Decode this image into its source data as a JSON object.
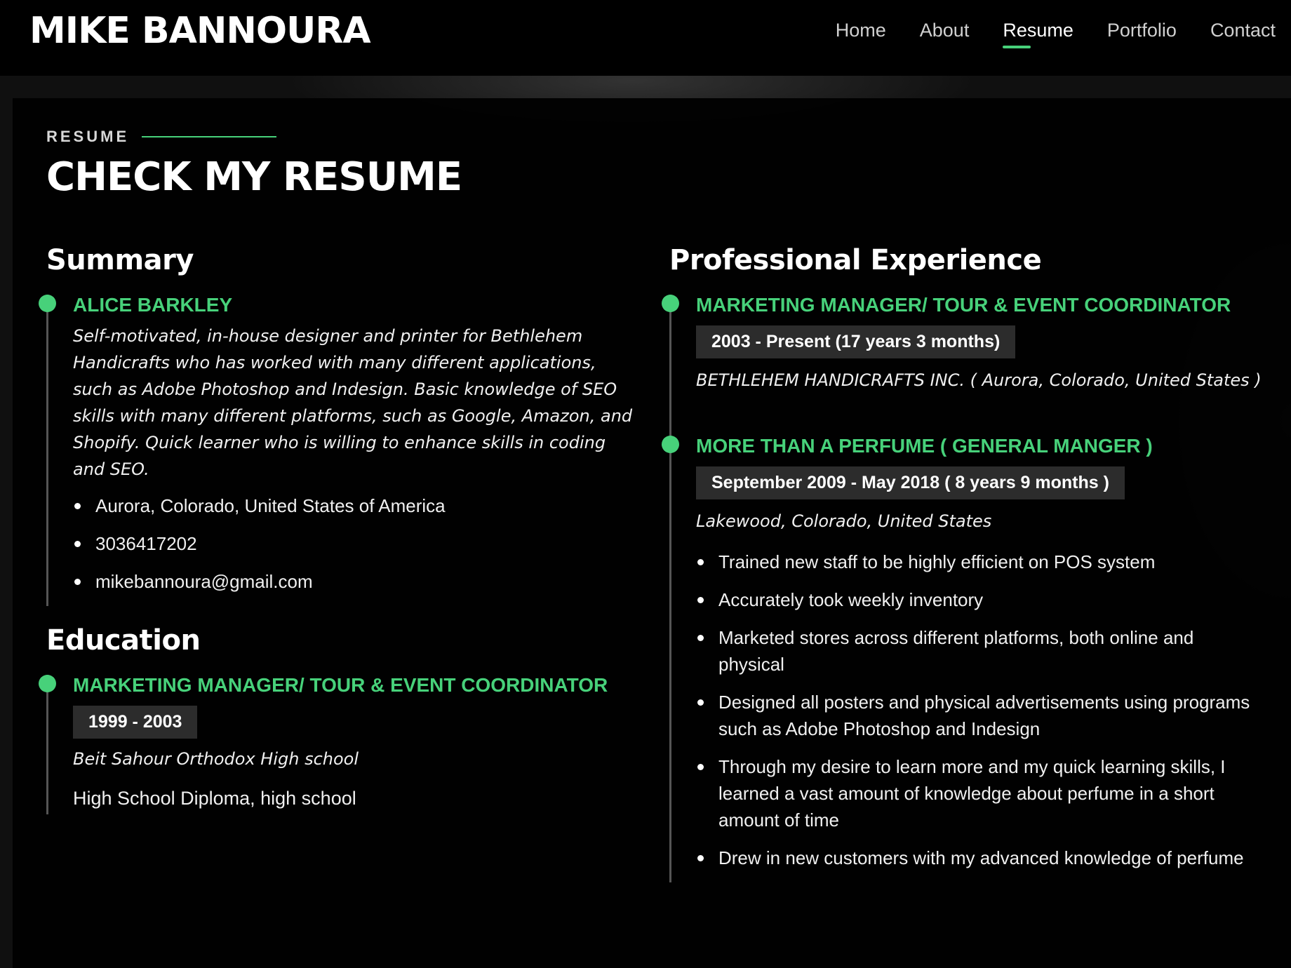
{
  "header": {
    "logo": "MIKE BANNOURA",
    "nav": [
      {
        "label": "Home",
        "active": false
      },
      {
        "label": "About",
        "active": false
      },
      {
        "label": "Resume",
        "active": true
      },
      {
        "label": "Portfolio",
        "active": false
      },
      {
        "label": "Contact",
        "active": false
      }
    ]
  },
  "section": {
    "eyebrow": "RESUME",
    "title": "CHECK MY RESUME"
  },
  "summary": {
    "heading": "Summary",
    "name": "ALICE BARKLEY",
    "description": "Self-motivated, in-house designer and printer for Bethlehem Handicrafts who has worked with many different applications, such as Adobe Photoshop and Indesign. Basic knowledge of SEO skills with many different platforms, such as Google, Amazon, and Shopify. Quick learner who is willing to enhance skills in coding and SEO.",
    "details": [
      "Aurora, Colorado, United States of America",
      "3036417202",
      "mikebannoura@gmail.com"
    ]
  },
  "education": {
    "heading": "Education",
    "item": {
      "title": "MARKETING MANAGER/ TOUR & EVENT COORDINATOR",
      "date": "1999 - 2003",
      "place": "Beit Sahour Orthodox High school",
      "degree": "High School Diploma, high school"
    }
  },
  "experience": {
    "heading": "Professional Experience",
    "items": [
      {
        "title": "MARKETING MANAGER/ TOUR & EVENT COORDINATOR",
        "date": "2003 - Present (17 years 3 months)",
        "place": "BETHLEHEM HANDICRAFTS INC. ( Aurora, Colorado, United States )"
      },
      {
        "title": "MORE THAN A PERFUME ( GENERAL MANGER )",
        "date": "September 2009 - May 2018 ( 8 years 9 months )",
        "place": "Lakewood, Colorado, United States",
        "bullets": [
          "Trained new staff to be highly efficient on POS system",
          "Accurately took weekly inventory",
          "Marketed stores across different platforms, both online and physical",
          "Designed all posters and physical advertisements using programs such as Adobe Photoshop and Indesign",
          "Through my desire to learn more and my quick learning skills, I learned a vast amount of knowledge about perfume in a short amount of time",
          "Drew in new customers with my advanced knowledge of perfume"
        ]
      }
    ]
  },
  "colors": {
    "accent": "#47d17a",
    "background": "#000000",
    "date_badge": "#2c2c2c"
  }
}
